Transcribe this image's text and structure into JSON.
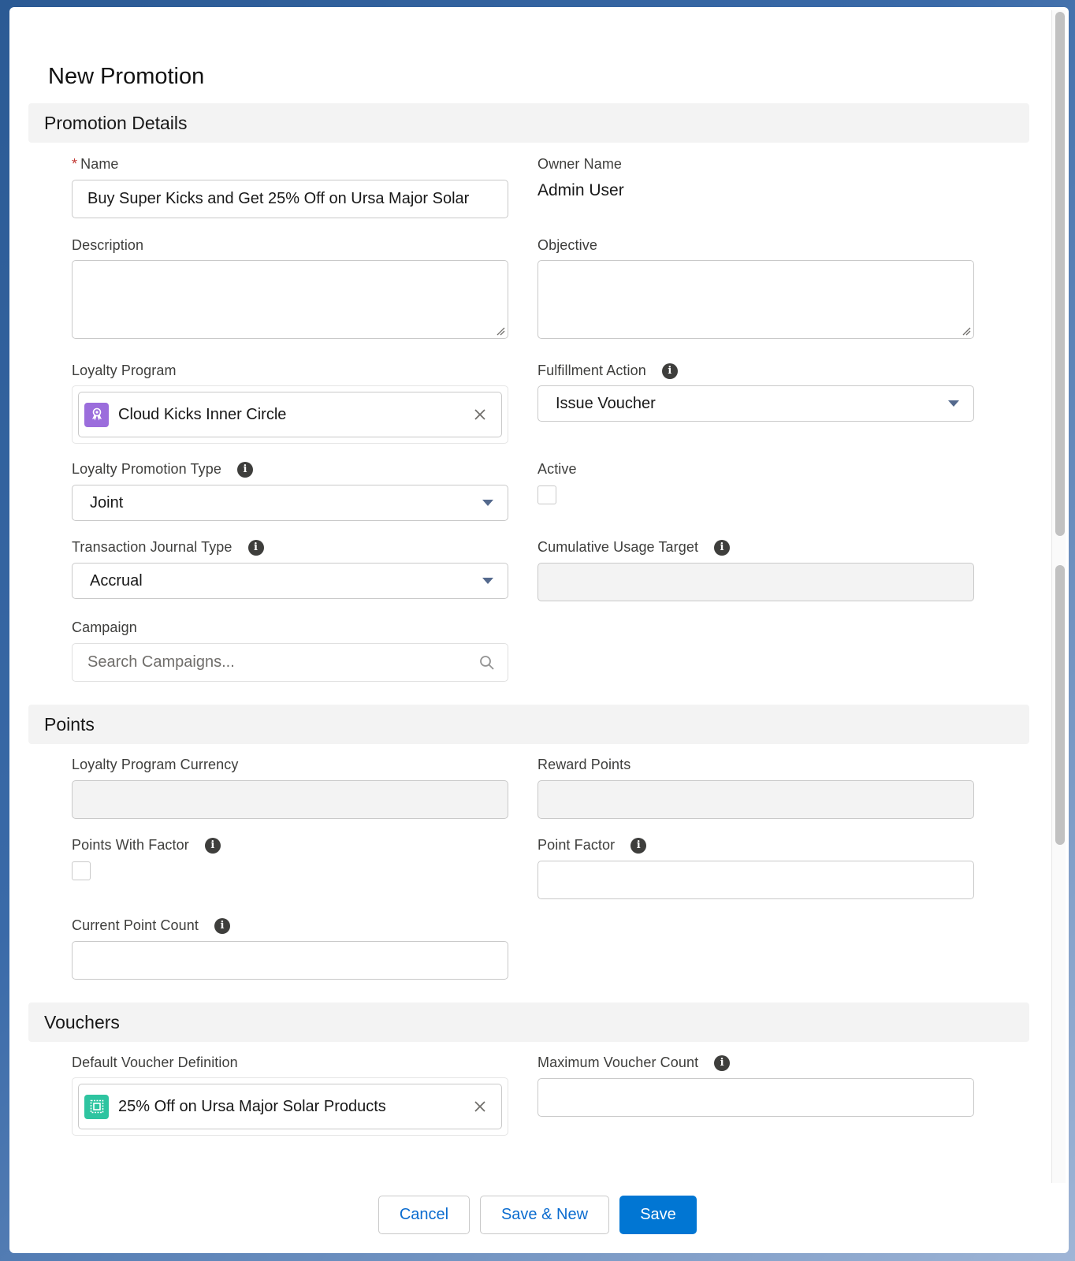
{
  "modal": {
    "title": "New Promotion"
  },
  "sections": {
    "details": "Promotion Details",
    "points": "Points",
    "vouchers": "Vouchers"
  },
  "fields": {
    "name": {
      "label": "Name",
      "required_marker": "*",
      "value": "Buy Super Kicks and Get 25% Off on Ursa Major Solar"
    },
    "owner_name": {
      "label": "Owner Name",
      "value": "Admin User"
    },
    "description": {
      "label": "Description",
      "value": ""
    },
    "objective": {
      "label": "Objective",
      "value": ""
    },
    "loyalty_program": {
      "label": "Loyalty Program",
      "value": "Cloud Kicks Inner Circle",
      "icon": "loyalty-program-icon"
    },
    "fulfillment_action": {
      "label": "Fulfillment Action",
      "value": "Issue Voucher"
    },
    "loyalty_promotion_type": {
      "label": "Loyalty Promotion Type",
      "value": "Joint"
    },
    "active": {
      "label": "Active",
      "checked": false
    },
    "transaction_journal_type": {
      "label": "Transaction Journal Type",
      "value": "Accrual"
    },
    "cumulative_usage_target": {
      "label": "Cumulative Usage Target",
      "value": ""
    },
    "campaign": {
      "label": "Campaign",
      "placeholder": "Search Campaigns...",
      "value": ""
    },
    "loyalty_program_currency": {
      "label": "Loyalty Program Currency",
      "value": ""
    },
    "reward_points": {
      "label": "Reward Points",
      "value": ""
    },
    "points_with_factor": {
      "label": "Points With Factor",
      "checked": false
    },
    "point_factor": {
      "label": "Point Factor",
      "value": ""
    },
    "current_point_count": {
      "label": "Current Point Count",
      "value": ""
    },
    "default_voucher_definition": {
      "label": "Default Voucher Definition",
      "value": "25% Off on Ursa Major Solar Products",
      "icon": "voucher-icon"
    },
    "maximum_voucher_count": {
      "label": "Maximum Voucher Count",
      "value": ""
    }
  },
  "info_glyph": "i",
  "footer": {
    "cancel": "Cancel",
    "save_new": "Save & New",
    "save": "Save"
  },
  "colors": {
    "brand": "#0176d3",
    "required": "#c23934",
    "loyalty_icon_bg": "#9b6ddc",
    "voucher_icon_bg": "#2ec4a0"
  }
}
